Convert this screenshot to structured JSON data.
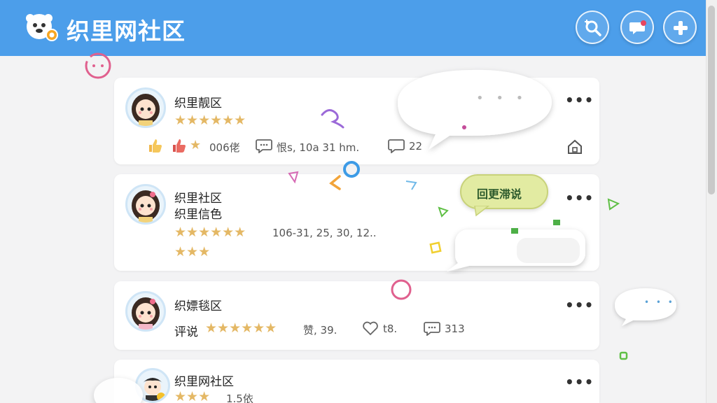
{
  "header": {
    "brand": "织里网社区",
    "icons": [
      "search-plus-icon",
      "message-notification-icon",
      "add-icon"
    ]
  },
  "posts": [
    {
      "name": "织里靓区",
      "stars": "★★★★★★",
      "likes": "006佬",
      "comment_meta": "恨s, 10a 31 hm.",
      "reply_count": "22"
    },
    {
      "name": "织里社区",
      "name2": "织里信色",
      "stars": "★★★★★★",
      "stats": "106-31, 25, 30, 12..",
      "stars2": "★★★"
    },
    {
      "name": "织嫖毯区",
      "label": "评说",
      "stars": "★★★★★★",
      "praise": "赞, 39.",
      "likes": "t8.",
      "comments": "313"
    },
    {
      "name": "织里网社区",
      "stars": "★★★",
      "count": "1.5依"
    }
  ],
  "bubbles": {
    "green_label": "回更滞说",
    "dots": "• • •",
    "small_dots": "• • •"
  },
  "colors": {
    "header": "#4c9eea",
    "star": "#e4b865",
    "accent_pink": "#e0608e"
  }
}
